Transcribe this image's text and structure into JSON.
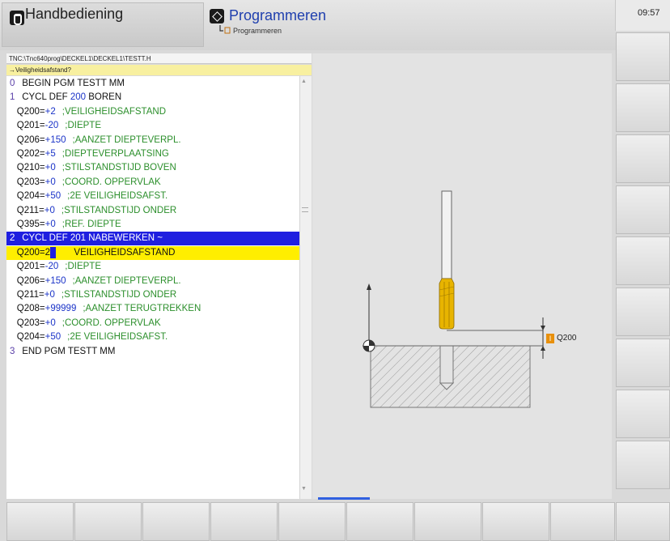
{
  "header": {
    "mode_left_label": "Handbediening",
    "mode_right_label": "Programmeren",
    "sub_label": "Programmeren",
    "clock": "09:57"
  },
  "program": {
    "path": "TNC:\\Tnc640prog\\DECKEL1\\DECKEL1\\TESTT.H",
    "prompt": "→Veiligheidsafstand?",
    "lines": [
      {
        "n": "0",
        "kw": "BEGIN PGM TESTT MM"
      },
      {
        "n": "1",
        "kw": "CYCL DEF ",
        "num": "200",
        "kw2": " BOREN"
      },
      {
        "param": "Q200=",
        "val": "+2",
        "cmt": ";VEILIGHEIDSAFSTAND"
      },
      {
        "param": "Q201=",
        "val": "-20",
        "cmt": ";DIEPTE"
      },
      {
        "param": "Q206=",
        "val": "+150",
        "cmt": ";AANZET DIEPTEVERPL."
      },
      {
        "param": "Q202=",
        "val": "+5",
        "cmt": ";DIEPTEVERPLAATSING"
      },
      {
        "param": "Q210=",
        "val": "+0",
        "cmt": ";STILSTANDSTIJD BOVEN"
      },
      {
        "param": "Q203=",
        "val": "+0",
        "cmt": ";COORD. OPPERVLAK"
      },
      {
        "param": "Q204=",
        "val": "+50",
        "cmt": ";2E VEILIGHEIDSAFST."
      },
      {
        "param": "Q211=",
        "val": "+0",
        "cmt": ";STILSTANDSTIJD ONDER"
      },
      {
        "param": "Q395=",
        "val": "+0",
        "cmt": ";REF. DIEPTE"
      },
      {
        "n": "2",
        "kw": "CYCL DEF 201 NABEWERKEN ~"
      },
      {
        "param": "Q200=",
        "val": "2",
        "cmt": "VEILIGHEIDSAFSTAND"
      },
      {
        "param": "Q201=",
        "val": "-20",
        "cmt": ";DIEPTE"
      },
      {
        "param": "Q206=",
        "val": "+150",
        "cmt": ";AANZET DIEPTEVERPL."
      },
      {
        "param": "Q211=",
        "val": "+0",
        "cmt": ";STILSTANDSTIJD ONDER"
      },
      {
        "param": "Q208=",
        "val": "+99999",
        "cmt": ";AANZET TERUGTREKKEN"
      },
      {
        "param": "Q203=",
        "val": "+0",
        "cmt": ";COORD. OPPERVLAK"
      },
      {
        "param": "Q204=",
        "val": "+50",
        "cmt": ";2E VEILIGHEIDSAFST."
      },
      {
        "n": "3",
        "kw": "END PGM TESTT MM"
      }
    ]
  },
  "graphic": {
    "dimension_label": "Q200",
    "badge": "I"
  },
  "colors": {
    "selection_blue": "#1f1fe0",
    "input_yellow": "#ffee00",
    "comment_green": "#2c8f2c",
    "number_blue": "#1a33c8",
    "tool_yellow": "#e8b400"
  },
  "icons": {
    "mode_left": "manual-operation-icon",
    "mode_right": "programming-icon"
  }
}
